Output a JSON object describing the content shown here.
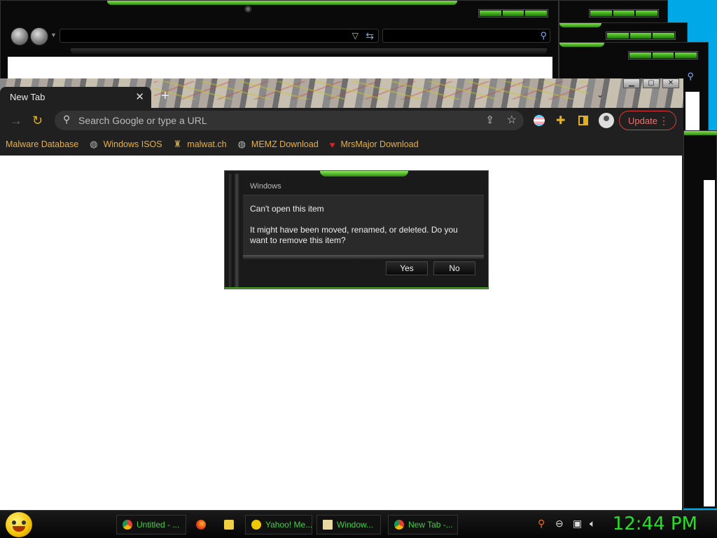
{
  "chrome": {
    "tab_title": "New Tab",
    "tab_close": "✕",
    "new_tab": "+",
    "omnibox_placeholder": "Search Google or type a URL",
    "update_label": "Update",
    "update_menu": "⋮",
    "window_buttons": [
      "▁",
      "▢",
      "✕"
    ]
  },
  "bookmarks": [
    {
      "label": "Malware Database",
      "icon": ""
    },
    {
      "label": "Windows ISOS",
      "icon": "globe-icon"
    },
    {
      "label": "malwat.ch",
      "icon": "figure-icon"
    },
    {
      "label": "MEMZ Download",
      "icon": "globe-icon"
    },
    {
      "label": "MrsMajor Download",
      "icon": "heart-icon"
    }
  ],
  "dialog": {
    "title": "Windows",
    "heading": "Can't open this item",
    "message": "It might have been moved, renamed, or deleted. Do you want to remove this item?",
    "yes_label": "Yes",
    "no_label": "No"
  },
  "taskbar": {
    "items": [
      {
        "label": "Untitled - ...",
        "icon": "chrome-icon"
      },
      {
        "label": "",
        "icon": "firefox-icon"
      },
      {
        "label": "",
        "icon": "folder-icon"
      },
      {
        "label": "Yahoo! Me...",
        "icon": "smiley-icon"
      },
      {
        "label": "Window...",
        "icon": "window-icon"
      },
      {
        "label": "New Tab -...",
        "icon": "chrome-icon"
      }
    ],
    "clock": "12:44 PM"
  },
  "colors": {
    "accent_green": "#3aa01a",
    "bookmark_text": "#e8b040",
    "update_red": "#e03a3a",
    "clock_green": "#25e025"
  }
}
